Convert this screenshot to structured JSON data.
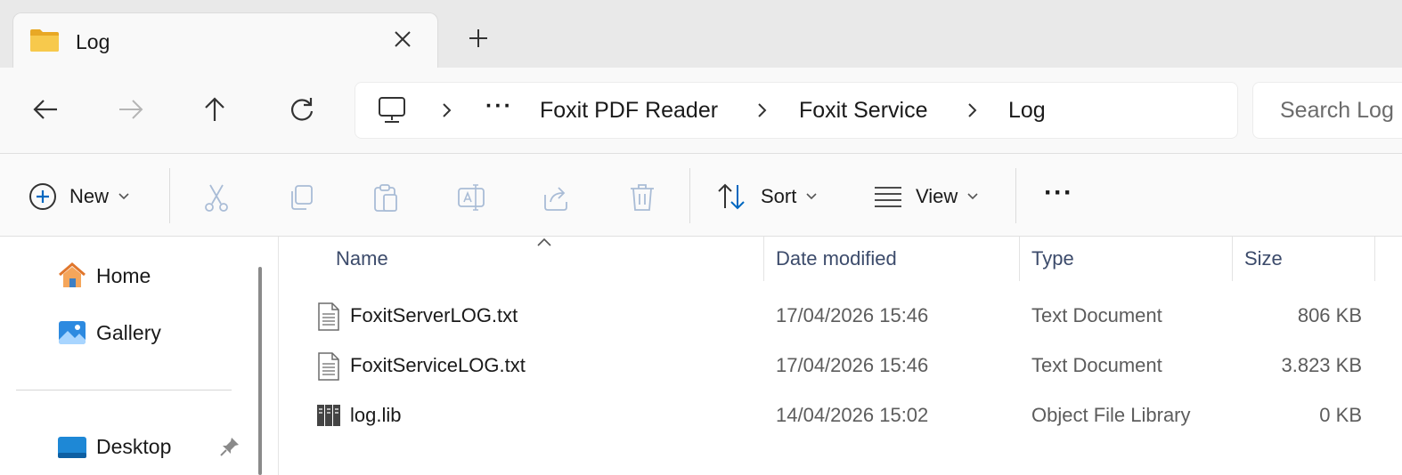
{
  "tab": {
    "title": "Log",
    "icon": "folder-icon"
  },
  "nav": {
    "crumbs": [
      "Foxit PDF Reader",
      "Foxit Service",
      "Log"
    ],
    "ellipsis": "···",
    "search_placeholder": "Search Log"
  },
  "toolbar": {
    "new_label": "New",
    "sort_label": "Sort",
    "view_label": "View",
    "more_label": "···"
  },
  "sidebar": {
    "items": [
      {
        "label": "Home",
        "icon": "home-icon"
      },
      {
        "label": "Gallery",
        "icon": "gallery-icon"
      },
      {
        "label": "Desktop",
        "icon": "desktop-icon",
        "pinned": true
      }
    ]
  },
  "columns": [
    "Name",
    "Date modified",
    "Type",
    "Size"
  ],
  "files": [
    {
      "name": "FoxitServerLOG.txt",
      "date": "17/04/2026 15:46",
      "type": "Text Document",
      "size": "806 KB",
      "icon": "text-document-icon"
    },
    {
      "name": "FoxitServiceLOG.txt",
      "date": "17/04/2026 15:46",
      "type": "Text Document",
      "size": "3.823 KB",
      "icon": "text-document-icon"
    },
    {
      "name": "log.lib",
      "date": "14/04/2026 15:02",
      "type": "Object File Library",
      "size": "0 KB",
      "icon": "library-icon"
    }
  ],
  "colors": {
    "accent": "#0067c0",
    "folder": "#f4c04a",
    "tabbar": "#e9e9e9"
  }
}
